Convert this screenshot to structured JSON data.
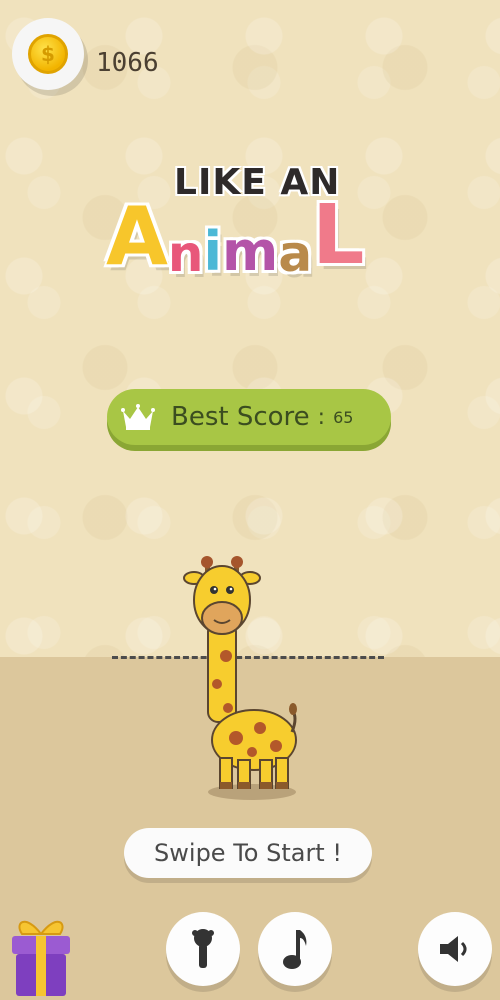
{
  "currency": {
    "amount": "1066",
    "coin_symbol": "$"
  },
  "logo": {
    "line1": "LIKE AN",
    "line2_letters": [
      "A",
      "n",
      "i",
      "m",
      "a",
      "L"
    ]
  },
  "best_score": {
    "label": "Best Score",
    "separator": ":",
    "value": "65"
  },
  "start": {
    "label": "Swipe To Start !"
  },
  "icons": {
    "coin": "coin-icon",
    "crown": "crown-icon",
    "gift": "gift-icon",
    "character": "character-select-icon",
    "music": "music-note-icon",
    "sound": "speaker-icon"
  },
  "colors": {
    "background": "#f0e2bd",
    "ground": "#dcc79c",
    "score_bar": "#a8c645",
    "giraffe_body": "#f7cd2e",
    "giraffe_spots": "#b3582a"
  }
}
